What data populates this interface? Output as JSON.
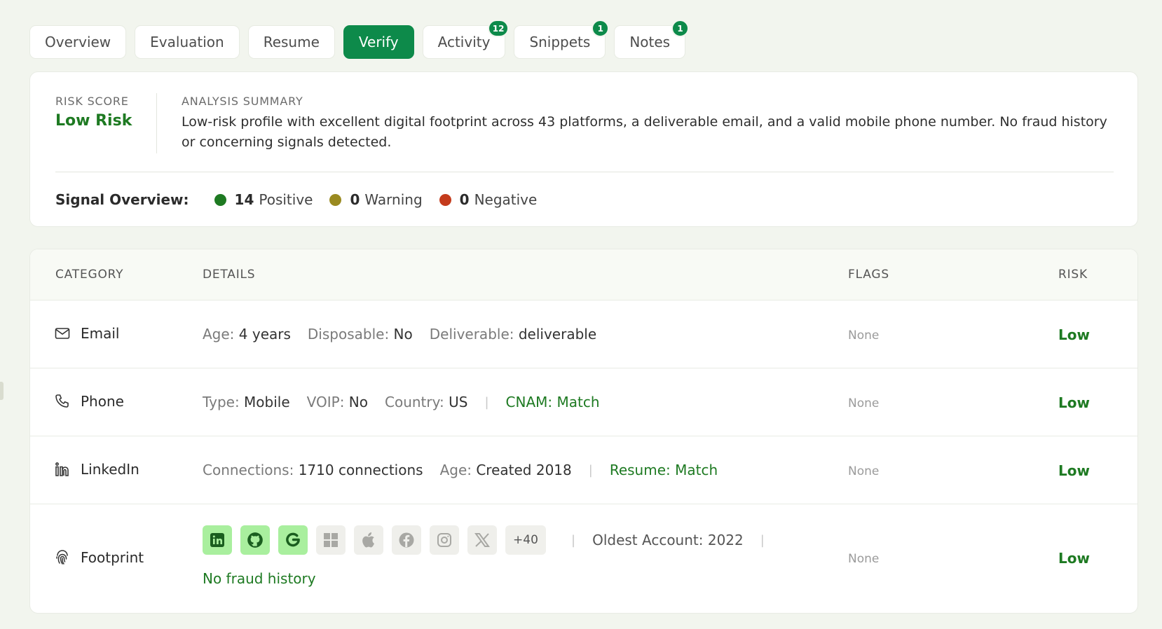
{
  "tabs": [
    {
      "label": "Overview"
    },
    {
      "label": "Evaluation"
    },
    {
      "label": "Resume"
    },
    {
      "label": "Verify",
      "active": true
    },
    {
      "label": "Activity",
      "badge": "12"
    },
    {
      "label": "Snippets",
      "badge": "1"
    },
    {
      "label": "Notes",
      "badge": "1"
    }
  ],
  "summary": {
    "risk_score_label": "RISK SCORE",
    "risk_value": "Low Risk",
    "analysis_label": "ANALYSIS SUMMARY",
    "analysis_text": "Low-risk profile with excellent digital footprint across 43 platforms, a deliverable email, and a valid mobile phone number. No fraud history or concerning signals detected.",
    "signal_label": "Signal Overview:",
    "signals": [
      {
        "count": "14",
        "label": "Positive",
        "color": "#1e7a22"
      },
      {
        "count": "0",
        "label": "Warning",
        "color": "#9a8a20"
      },
      {
        "count": "0",
        "label": "Negative",
        "color": "#c43b1c"
      }
    ]
  },
  "table": {
    "headers": {
      "category": "CATEGORY",
      "details": "DETAILS",
      "flags": "FLAGS",
      "risk": "RISK"
    },
    "rows": {
      "email": {
        "category": "Email",
        "icon": "mail-icon",
        "age_key": "Age:",
        "age_val": "4 years",
        "disp_key": "Disposable:",
        "disp_val": "No",
        "deliv_key": "Deliverable:",
        "deliv_val": "deliverable",
        "flags": "None",
        "risk": "Low"
      },
      "phone": {
        "category": "Phone",
        "icon": "phone-icon",
        "type_key": "Type:",
        "type_val": "Mobile",
        "voip_key": "VOIP:",
        "voip_val": "No",
        "country_key": "Country:",
        "country_val": "US",
        "separator": "|",
        "cnam": "CNAM: Match",
        "flags": "None",
        "risk": "Low"
      },
      "linkedin": {
        "category": "LinkedIn",
        "icon": "linkedin-icon",
        "conn_key": "Connections:",
        "conn_val": "1710 connections",
        "age_key": "Age:",
        "age_val": "Created 2018",
        "separator": "|",
        "resume": "Resume: Match",
        "flags": "None",
        "risk": "Low"
      },
      "footprint": {
        "category": "Footprint",
        "icon": "fingerprint-icon",
        "platforms": [
          {
            "name": "linkedin-icon",
            "active": true
          },
          {
            "name": "github-icon",
            "active": true
          },
          {
            "name": "google-icon",
            "active": true
          },
          {
            "name": "microsoft-icon",
            "active": false
          },
          {
            "name": "apple-icon",
            "active": false
          },
          {
            "name": "facebook-icon",
            "active": false
          },
          {
            "name": "instagram-icon",
            "active": false
          },
          {
            "name": "x-icon",
            "active": false
          }
        ],
        "more": "+40",
        "separator": "|",
        "oldest": "Oldest Account: 2022",
        "fraud": "No fraud history",
        "flags": "None",
        "risk": "Low"
      }
    }
  }
}
